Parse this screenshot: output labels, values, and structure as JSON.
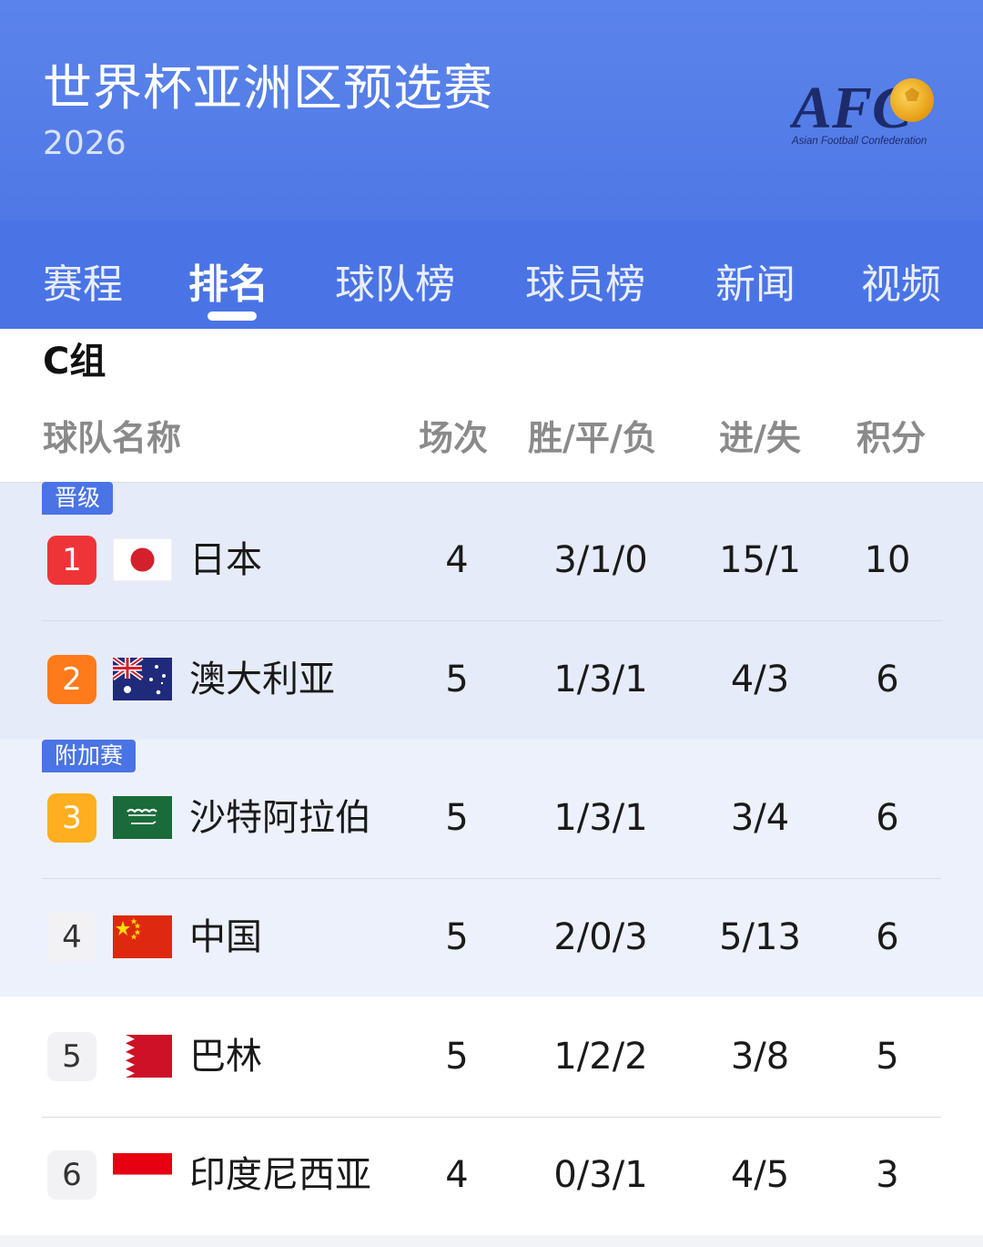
{
  "header": {
    "title": "世界杯亚洲区预选赛",
    "year": "2026",
    "logo": {
      "wordmark": "AFC",
      "subtitle": "Asian Football Confederation"
    }
  },
  "tabs": [
    {
      "label": "赛程",
      "active": false
    },
    {
      "label": "排名",
      "active": true
    },
    {
      "label": "球队榜",
      "active": false
    },
    {
      "label": "球员榜",
      "active": false
    },
    {
      "label": "新闻",
      "active": false
    },
    {
      "label": "视频",
      "active": false
    }
  ],
  "group": {
    "title": "C组",
    "columns": {
      "team": "球队名称",
      "played": "场次",
      "wdl": "胜/平/负",
      "goals": "进/失",
      "points": "积分"
    },
    "zones": {
      "qualified": "晋级",
      "playoff": "附加赛"
    },
    "rows": [
      {
        "rank": "1",
        "flag": "japan-flag",
        "team": "日本",
        "played": "4",
        "wdl": "3/1/0",
        "goals": "15/1",
        "points": "10"
      },
      {
        "rank": "2",
        "flag": "australia-flag",
        "team": "澳大利亚",
        "played": "5",
        "wdl": "1/3/1",
        "goals": "4/3",
        "points": "6"
      },
      {
        "rank": "3",
        "flag": "saudi-arabia-flag",
        "team": "沙特阿拉伯",
        "played": "5",
        "wdl": "1/3/1",
        "goals": "3/4",
        "points": "6"
      },
      {
        "rank": "4",
        "flag": "china-flag",
        "team": "中国",
        "played": "5",
        "wdl": "2/0/3",
        "goals": "5/13",
        "points": "6"
      },
      {
        "rank": "5",
        "flag": "bahrain-flag",
        "team": "巴林",
        "played": "5",
        "wdl": "1/2/2",
        "goals": "3/8",
        "points": "5"
      },
      {
        "rank": "6",
        "flag": "indonesia-flag",
        "team": "印度尼西亚",
        "played": "4",
        "wdl": "0/3/1",
        "goals": "4/5",
        "points": "3"
      }
    ]
  },
  "colors": {
    "header_blue": "#5b84ea",
    "tab_blue": "#4a74e5",
    "rank1": "#ef3438",
    "rank2": "#ff7a1a",
    "rank3": "#ffae1f"
  }
}
